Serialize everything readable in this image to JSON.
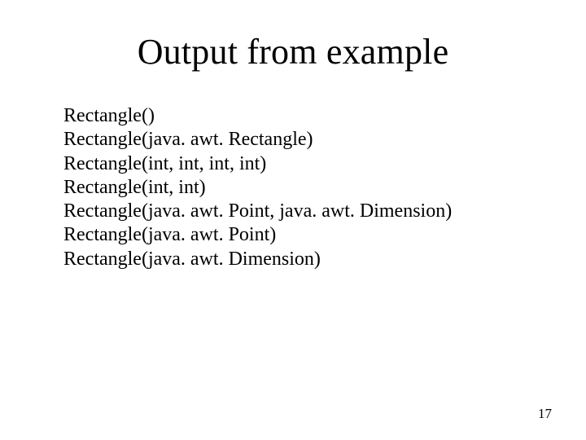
{
  "title": "Output from example",
  "lines": [
    "Rectangle()",
    "Rectangle(java. awt. Rectangle)",
    "Rectangle(int, int, int, int)",
    "Rectangle(int, int)",
    "Rectangle(java. awt. Point, java. awt. Dimension)",
    "Rectangle(java. awt. Point)",
    "Rectangle(java. awt. Dimension)"
  ],
  "page_number": "17"
}
